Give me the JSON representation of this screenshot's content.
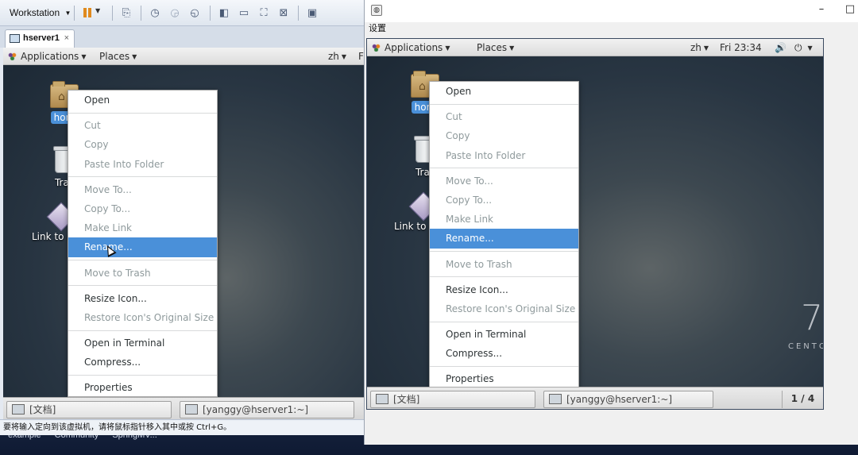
{
  "vmware": {
    "menu_label": "Workstation",
    "tab_label": "hserver1",
    "tab_close": "×",
    "status_message": "要将输入定向到该虚拟机，请将鼠标指针移入其中或按 Ctrl+G。"
  },
  "host_desktop": {
    "shortcuts": [
      "example",
      "Community",
      "SpringMV..."
    ]
  },
  "guest_left": {
    "topbar": {
      "applications": "Applications",
      "places": "Places",
      "lang": "zh",
      "clock_partial": "F"
    },
    "desktop_icons": {
      "home": "hom",
      "trash": "Tras",
      "link": "Link to e"
    },
    "context_menu": [
      {
        "label": "Open",
        "state": "normal"
      },
      {
        "sep": true
      },
      {
        "label": "Cut",
        "state": "disabled"
      },
      {
        "label": "Copy",
        "state": "disabled"
      },
      {
        "label": "Paste Into Folder",
        "state": "disabled"
      },
      {
        "sep": true
      },
      {
        "label": "Move To...",
        "state": "disabled"
      },
      {
        "label": "Copy To...",
        "state": "disabled"
      },
      {
        "label": "Make Link",
        "state": "disabled"
      },
      {
        "label": "Rename...",
        "state": "selected"
      },
      {
        "sep": true
      },
      {
        "label": "Move to Trash",
        "state": "disabled"
      },
      {
        "sep": true
      },
      {
        "label": "Resize Icon...",
        "state": "normal"
      },
      {
        "label": "Restore Icon's Original Size",
        "state": "disabled"
      },
      {
        "sep": true
      },
      {
        "label": "Open in Terminal",
        "state": "normal"
      },
      {
        "label": "Compress...",
        "state": "normal"
      },
      {
        "sep": true
      },
      {
        "label": "Properties",
        "state": "normal"
      }
    ],
    "taskbar": {
      "task1": "[文档]",
      "task2": "[yanggy@hserver1:~]"
    }
  },
  "guest_right": {
    "window_menu": "设置",
    "title_minimize": "–",
    "title_maximize": "□",
    "topbar": {
      "applications": "Applications",
      "places": "Places",
      "lang": "zh",
      "clock": "Fri 23:34"
    },
    "desktop_icons": {
      "home": "hom",
      "trash": "Tras",
      "link": "Link to e"
    },
    "branding": {
      "number": "7",
      "text": "CENTO"
    },
    "context_menu": [
      {
        "label": "Open",
        "state": "normal"
      },
      {
        "sep": true
      },
      {
        "label": "Cut",
        "state": "disabled"
      },
      {
        "label": "Copy",
        "state": "disabled"
      },
      {
        "label": "Paste Into Folder",
        "state": "disabled"
      },
      {
        "sep": true
      },
      {
        "label": "Move To...",
        "state": "disabled"
      },
      {
        "label": "Copy To...",
        "state": "disabled"
      },
      {
        "label": "Make Link",
        "state": "disabled"
      },
      {
        "label": "Rename...",
        "state": "selected"
      },
      {
        "sep": true
      },
      {
        "label": "Move to Trash",
        "state": "disabled"
      },
      {
        "sep": true
      },
      {
        "label": "Resize Icon...",
        "state": "normal"
      },
      {
        "label": "Restore Icon's Original Size",
        "state": "disabled"
      },
      {
        "sep": true
      },
      {
        "label": "Open in Terminal",
        "state": "normal"
      },
      {
        "label": "Compress...",
        "state": "normal"
      },
      {
        "sep": true
      },
      {
        "label": "Properties",
        "state": "normal"
      }
    ],
    "taskbar": {
      "task1": "[文档]",
      "task2": "[yanggy@hserver1:~]",
      "pager": "1 / 4"
    }
  },
  "colors": {
    "selection": "#4a90d9",
    "disabled_text": "#8f9a9c",
    "pause_accent": "#e08a1e"
  }
}
